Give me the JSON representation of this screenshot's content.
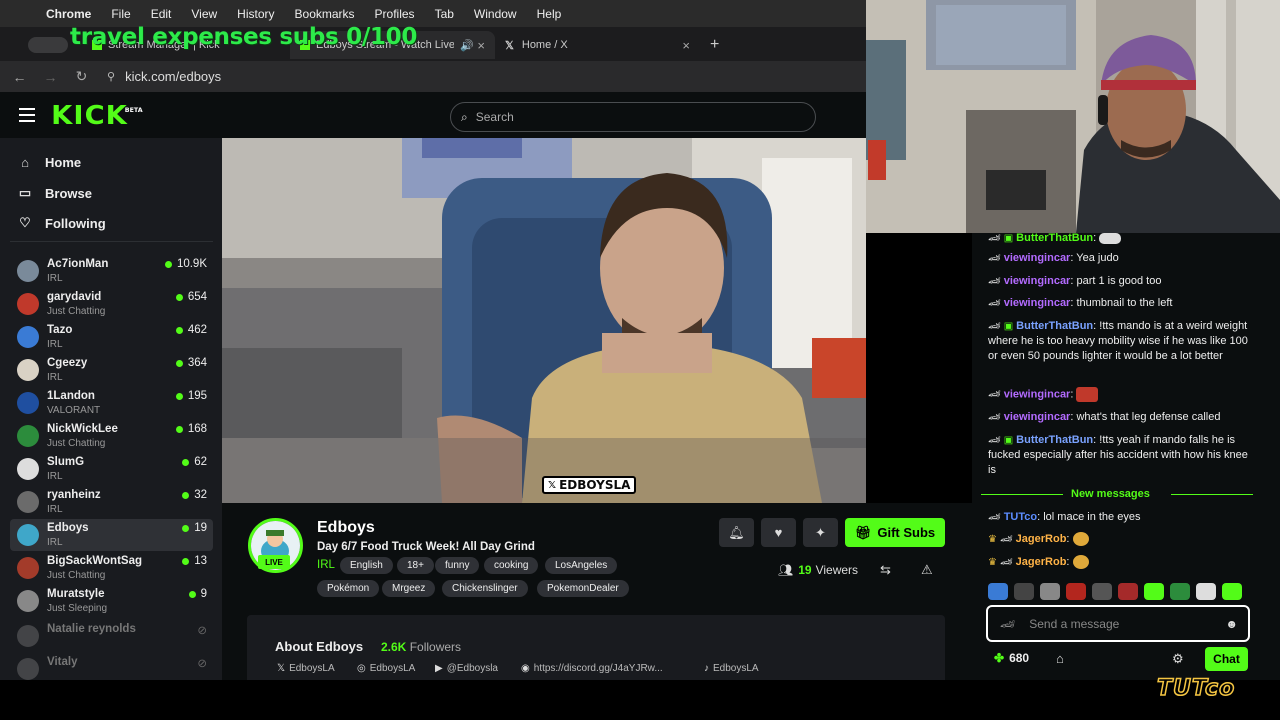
{
  "menubar": {
    "items": [
      "Chrome",
      "File",
      "Edit",
      "View",
      "History",
      "Bookmarks",
      "Profiles",
      "Tab",
      "Window",
      "Help"
    ]
  },
  "overlay": {
    "text": "travel expenses subs 0/100"
  },
  "browser": {
    "tabs": [
      {
        "label": "Stream Manager | Kick"
      },
      {
        "label": "Edboys Stream - Watch Live"
      },
      {
        "label": "Home / X"
      }
    ],
    "new_tab": "+",
    "url": "kick.com/edboys"
  },
  "kick": {
    "logo": "KICK",
    "beta": "BETA",
    "search_placeholder": "Search",
    "nav": [
      {
        "label": "Home",
        "icon": "home-icon"
      },
      {
        "label": "Browse",
        "icon": "browse-icon"
      },
      {
        "label": "Following",
        "icon": "heart-icon"
      }
    ],
    "channels": [
      {
        "name": "Ac7ionMan",
        "category": "IRL",
        "viewers": "10.9K",
        "color": "#7a8a9a"
      },
      {
        "name": "garydavid",
        "category": "Just Chatting",
        "viewers": "654",
        "color": "#c0392b"
      },
      {
        "name": "Tazo",
        "category": "IRL",
        "viewers": "462",
        "color": "#3a7bd5"
      },
      {
        "name": "Cgeezy",
        "category": "IRL",
        "viewers": "364",
        "color": "#d9d2c5"
      },
      {
        "name": "1Landon",
        "category": "VALORANT",
        "viewers": "195",
        "color": "#1f4fa0"
      },
      {
        "name": "NickWickLee",
        "category": "Just Chatting",
        "viewers": "168",
        "color": "#2c8c3c"
      },
      {
        "name": "SlumG",
        "category": "IRL",
        "viewers": "62",
        "color": "#dddddd"
      },
      {
        "name": "ryanheinz",
        "category": "IRL",
        "viewers": "32",
        "color": "#6b6b6b"
      },
      {
        "name": "Edboys",
        "category": "IRL",
        "viewers": "19",
        "color": "#3fa7c9"
      },
      {
        "name": "BigSackWontSag",
        "category": "Just Chatting",
        "viewers": "13",
        "color": "#a33b2a"
      },
      {
        "name": "Muratstyle",
        "category": "Just Sleeping",
        "viewers": "9",
        "color": "#888888"
      },
      {
        "name": "Natalie reynolds",
        "category": "",
        "viewers": "",
        "color": "#777777"
      },
      {
        "name": "Vitaly",
        "category": "",
        "viewers": "",
        "color": "#777777"
      }
    ]
  },
  "video": {
    "watermark": "EDBOYSLA"
  },
  "channel": {
    "name": "Edboys",
    "live": "LIVE",
    "title": "Day 6/7 Food Truck Week! All Day Grind",
    "category": "IRL",
    "tags_row1": [
      "English",
      "18+",
      "funny",
      "cooking",
      "LosAngeles"
    ],
    "tags_row2": [
      "Pokémon",
      "Mrgeez",
      "Chickenslinger",
      "PokemonDealer"
    ],
    "gift_label": "Gift Subs",
    "viewers_count": "19",
    "viewers_label": "Viewers",
    "about_title": "About Edboys",
    "followers_count": "2.6K",
    "followers_label": "Followers",
    "socials": [
      {
        "icon": "x-icon",
        "label": "EdboysLA"
      },
      {
        "icon": "instagram-icon",
        "label": "EdboysLA"
      },
      {
        "icon": "youtube-icon",
        "label": "@Edboysla"
      },
      {
        "icon": "discord-icon",
        "label": "https://discord.gg/J4aYJRw..."
      },
      {
        "icon": "tiktok-icon",
        "label": "EdboysLA"
      }
    ]
  },
  "chat": {
    "messages": [
      {
        "user": "ButterThatBun",
        "text": "",
        "color": "#53fc18"
      },
      {
        "user": "viewingincar",
        "text": "Yea judo",
        "color": "#b36bff"
      },
      {
        "user": "viewingincar",
        "text": "part 1 is good too",
        "color": "#b36bff"
      },
      {
        "user": "viewingincar",
        "text": "thumbnail to the left",
        "color": "#b36bff"
      },
      {
        "user": "ButterThatBun",
        "text": "!tts mando is at a weird weight where he is too heavy mobility wise if he was like 100 or even 50 pounds lighter it would be a lot better",
        "color": "#7aa2ff"
      },
      {
        "user": "viewingincar",
        "text": "",
        "color": "#b36bff"
      },
      {
        "user": "viewingincar",
        "text": "what's that leg defense called",
        "color": "#b36bff"
      },
      {
        "user": "ButterThatBun",
        "text": "!tts yeah if mando falls he is fucked especially after his accident with how his knee is",
        "color": "#7aa2ff"
      },
      {
        "user": "TUTco",
        "text": "lol mace in the eyes",
        "color": "#5b8cff"
      },
      {
        "user": "JagerRob",
        "text": "",
        "color": "#ffb347"
      },
      {
        "user": "JagerRob",
        "text": "",
        "color": "#ffb347"
      }
    ],
    "new_messages": "New messages",
    "input_placeholder": "Send a message",
    "points": "680",
    "chat_button": "Chat"
  },
  "branding": {
    "tutco": "TUTco"
  },
  "colors": {
    "accent": "#53fc18",
    "bg": "#0b0e0f",
    "sidebar": "#191b1f"
  }
}
